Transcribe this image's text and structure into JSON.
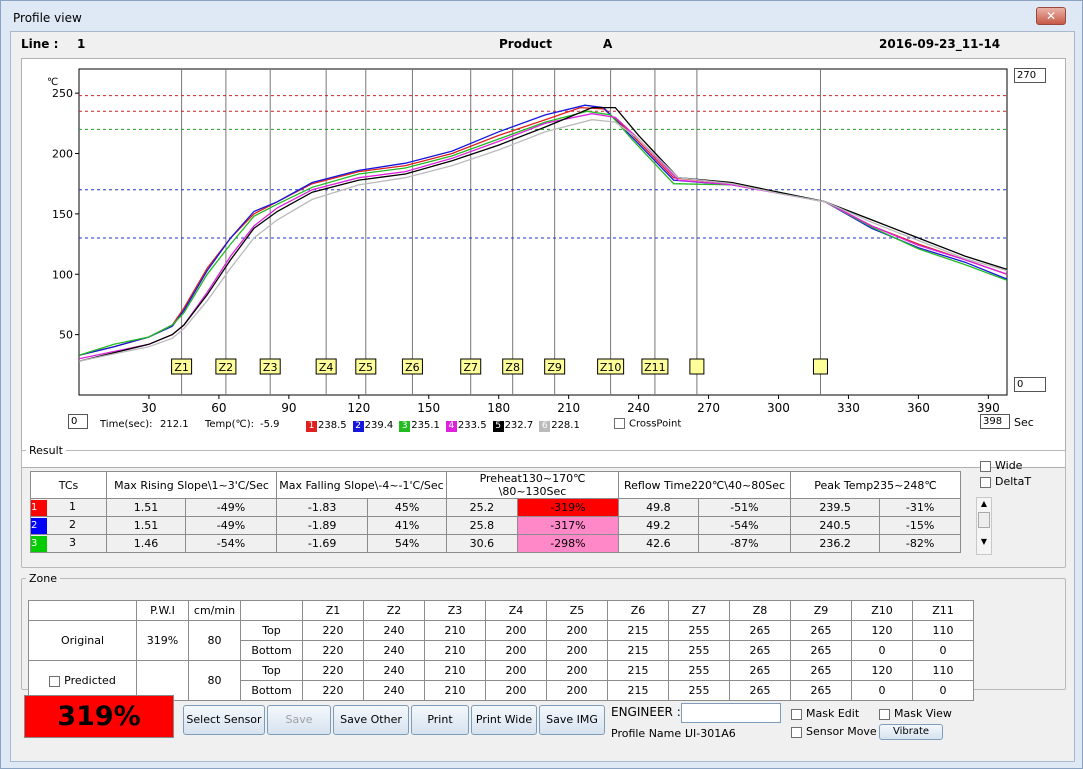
{
  "window": {
    "title": "Profile view",
    "close_glyph": "✕"
  },
  "infobar": {
    "line_label": "Line :",
    "line_value": "1",
    "product_label": "Product",
    "product_value": "A",
    "datetime": "2016-09-23_11-14"
  },
  "chart_data": {
    "type": "line",
    "ylabel": "℃",
    "xlabel": "Sec",
    "xlim": [
      0,
      398
    ],
    "ylim": [
      0,
      270
    ],
    "x_ticks": [
      30,
      60,
      90,
      120,
      150,
      180,
      210,
      240,
      270,
      300,
      330,
      360,
      390
    ],
    "y_ticks": [
      50,
      100,
      150,
      200,
      250
    ],
    "reference_lines": [
      {
        "y": 248,
        "color": "#cc2222"
      },
      {
        "y": 235,
        "color": "#cc2222"
      },
      {
        "y": 220,
        "color": "#229922"
      },
      {
        "y": 170,
        "color": "#2233cc"
      },
      {
        "y": 130,
        "color": "#2233cc"
      }
    ],
    "zone_markers": [
      {
        "label": "Z1",
        "x": 44
      },
      {
        "label": "Z2",
        "x": 63
      },
      {
        "label": "Z3",
        "x": 82
      },
      {
        "label": "Z4",
        "x": 106
      },
      {
        "label": "Z5",
        "x": 123
      },
      {
        "label": "Z6",
        "x": 143
      },
      {
        "label": "Z7",
        "x": 168
      },
      {
        "label": "Z8",
        "x": 186
      },
      {
        "label": "Z9",
        "x": 204
      },
      {
        "label": "Z10",
        "x": 228
      },
      {
        "label": "Z11",
        "x": 247
      },
      {
        "label": "",
        "x": 265
      },
      {
        "label": "",
        "x": 318
      }
    ],
    "series": [
      {
        "color": "#e02020",
        "x": [
          0,
          15,
          30,
          40,
          45,
          55,
          65,
          75,
          85,
          100,
          120,
          140,
          160,
          180,
          200,
          215,
          225,
          235,
          255,
          280,
          300,
          320,
          340,
          360,
          380,
          398
        ],
        "y": [
          33,
          40,
          48,
          58,
          72,
          105,
          130,
          150,
          160,
          175,
          185,
          190,
          200,
          215,
          228,
          238,
          237,
          220,
          180,
          175,
          168,
          160,
          140,
          125,
          112,
          100
        ]
      },
      {
        "color": "#1515dd",
        "x": [
          0,
          15,
          30,
          40,
          45,
          55,
          65,
          75,
          85,
          100,
          120,
          140,
          160,
          180,
          200,
          217,
          225,
          235,
          255,
          280,
          300,
          320,
          340,
          360,
          380,
          398
        ],
        "y": [
          33,
          40,
          48,
          57,
          70,
          103,
          130,
          152,
          160,
          176,
          186,
          192,
          202,
          218,
          232,
          240,
          238,
          218,
          178,
          174,
          168,
          160,
          138,
          122,
          110,
          96
        ]
      },
      {
        "color": "#22bb22",
        "x": [
          0,
          15,
          30,
          40,
          45,
          55,
          65,
          75,
          85,
          100,
          120,
          140,
          160,
          180,
          200,
          218,
          228,
          238,
          255,
          280,
          300,
          320,
          340,
          360,
          380,
          398
        ],
        "y": [
          33,
          42,
          48,
          58,
          68,
          100,
          125,
          148,
          158,
          172,
          183,
          188,
          198,
          212,
          226,
          235,
          232,
          210,
          175,
          174,
          168,
          160,
          139,
          121,
          108,
          95
        ]
      },
      {
        "color": "#dd22dd",
        "x": [
          0,
          15,
          30,
          40,
          45,
          55,
          65,
          75,
          85,
          100,
          120,
          140,
          160,
          180,
          200,
          220,
          230,
          240,
          257,
          280,
          300,
          320,
          340,
          360,
          380,
          398
        ],
        "y": [
          30,
          36,
          42,
          50,
          58,
          85,
          115,
          140,
          155,
          170,
          180,
          185,
          196,
          210,
          225,
          233,
          230,
          212,
          178,
          174,
          167,
          160,
          140,
          124,
          112,
          100
        ]
      },
      {
        "color": "#000000",
        "x": [
          0,
          15,
          30,
          40,
          45,
          55,
          65,
          75,
          85,
          100,
          120,
          140,
          160,
          180,
          200,
          220,
          230,
          240,
          257,
          280,
          300,
          320,
          340,
          360,
          380,
          398
        ],
        "y": [
          28,
          35,
          42,
          50,
          58,
          83,
          112,
          138,
          152,
          168,
          178,
          183,
          194,
          207,
          222,
          238,
          238,
          215,
          180,
          176,
          168,
          160,
          145,
          130,
          115,
          104
        ]
      },
      {
        "color": "#bbbbbb",
        "x": [
          0,
          15,
          30,
          40,
          45,
          55,
          65,
          75,
          85,
          100,
          120,
          140,
          160,
          180,
          200,
          220,
          230,
          240,
          257,
          280,
          300,
          320,
          340,
          360,
          380,
          398
        ],
        "y": [
          28,
          34,
          40,
          47,
          55,
          78,
          105,
          130,
          145,
          162,
          174,
          180,
          190,
          203,
          218,
          228,
          226,
          212,
          180,
          175,
          167,
          160,
          143,
          128,
          113,
          103
        ]
      }
    ]
  },
  "chart_ui": {
    "right_top_box": "270",
    "right_bottom_box": "0",
    "left_box": "0",
    "time_label": "Time(sec):",
    "time_value": "212.1",
    "temp_label": "Temp(℃):",
    "temp_value": "-5.9",
    "sec_box": "398",
    "sec_label": "Sec",
    "crosspoint_label": "CrossPoint",
    "tc_legend": [
      {
        "num": "1",
        "value": "238.5",
        "color": "#e02020"
      },
      {
        "num": "2",
        "value": "239.4",
        "color": "#1515dd"
      },
      {
        "num": "3",
        "value": "235.1",
        "color": "#22bb22"
      },
      {
        "num": "4",
        "value": "233.5",
        "color": "#dd22dd"
      },
      {
        "num": "5",
        "value": "232.7",
        "color": "#000000"
      },
      {
        "num": "6",
        "value": "228.1",
        "color": "#bbbbbb"
      }
    ]
  },
  "result": {
    "title": "Result",
    "headers": [
      "TCs",
      "Max Rising Slope\\1~3'C/Sec",
      "Max Falling Slope\\-4~-1'C/Sec",
      "Preheat130~170℃\\80~130Sec",
      "Reflow Time220℃\\40~80Sec",
      "Peak Temp235~248℃"
    ],
    "rows": [
      {
        "tc": "1",
        "color": "#ff0000",
        "cells": [
          "1.51",
          "-49%",
          "-1.83",
          "45%",
          "25.2",
          "-319%",
          "49.8",
          "-51%",
          "239.5",
          "-31%"
        ],
        "highlight": "#ff0000"
      },
      {
        "tc": "2",
        "color": "#0000ff",
        "cells": [
          "1.51",
          "-49%",
          "-1.89",
          "41%",
          "25.8",
          "-317%",
          "49.2",
          "-54%",
          "240.5",
          "-15%"
        ],
        "highlight": "#ff88c8"
      },
      {
        "tc": "3",
        "color": "#00cc00",
        "cells": [
          "1.46",
          "-54%",
          "-1.69",
          "54%",
          "30.6",
          "-298%",
          "42.6",
          "-87%",
          "236.2",
          "-82%"
        ],
        "highlight": "#ff88c8"
      }
    ],
    "wide_label": "Wide",
    "deltat_label": "DeltaT"
  },
  "zone": {
    "title": "Zone",
    "pwi_header": "P.W.I",
    "speed_header": "cm/min",
    "zone_headers": [
      "Z1",
      "Z2",
      "Z3",
      "Z4",
      "Z5",
      "Z6",
      "Z7",
      "Z8",
      "Z9",
      "Z10",
      "Z11"
    ],
    "original_label": "Original",
    "original_pwi": "319%",
    "original_speed": "80",
    "predicted_label": "Predicted",
    "predicted_speed": "80",
    "top_label": "Top",
    "bottom_label": "Bottom",
    "original_top": [
      "220",
      "240",
      "210",
      "200",
      "200",
      "215",
      "255",
      "265",
      "265",
      "120",
      "110"
    ],
    "original_bottom": [
      "220",
      "240",
      "210",
      "200",
      "200",
      "215",
      "255",
      "265",
      "265",
      "0",
      "0"
    ],
    "predicted_top": [
      "220",
      "240",
      "210",
      "200",
      "200",
      "215",
      "255",
      "265",
      "265",
      "120",
      "110"
    ],
    "predicted_bottom": [
      "220",
      "240",
      "210",
      "200",
      "200",
      "215",
      "255",
      "265",
      "265",
      "0",
      "0"
    ]
  },
  "footer": {
    "big_result": "319%",
    "buttons": {
      "select_sensor": "Select Sensor",
      "save": "Save",
      "save_other": "Save Other",
      "print": "Print",
      "print_wide": "Print Wide",
      "save_img": "Save IMG"
    },
    "engineer_label": "ENGINEER :",
    "profile_name_label": "Profile Name :",
    "profile_name_value": "UI-301A6",
    "mask_edit": "Mask Edit",
    "mask_view": "Mask View",
    "sensor_move": "Sensor Move",
    "vibrate": "Vibrate"
  }
}
